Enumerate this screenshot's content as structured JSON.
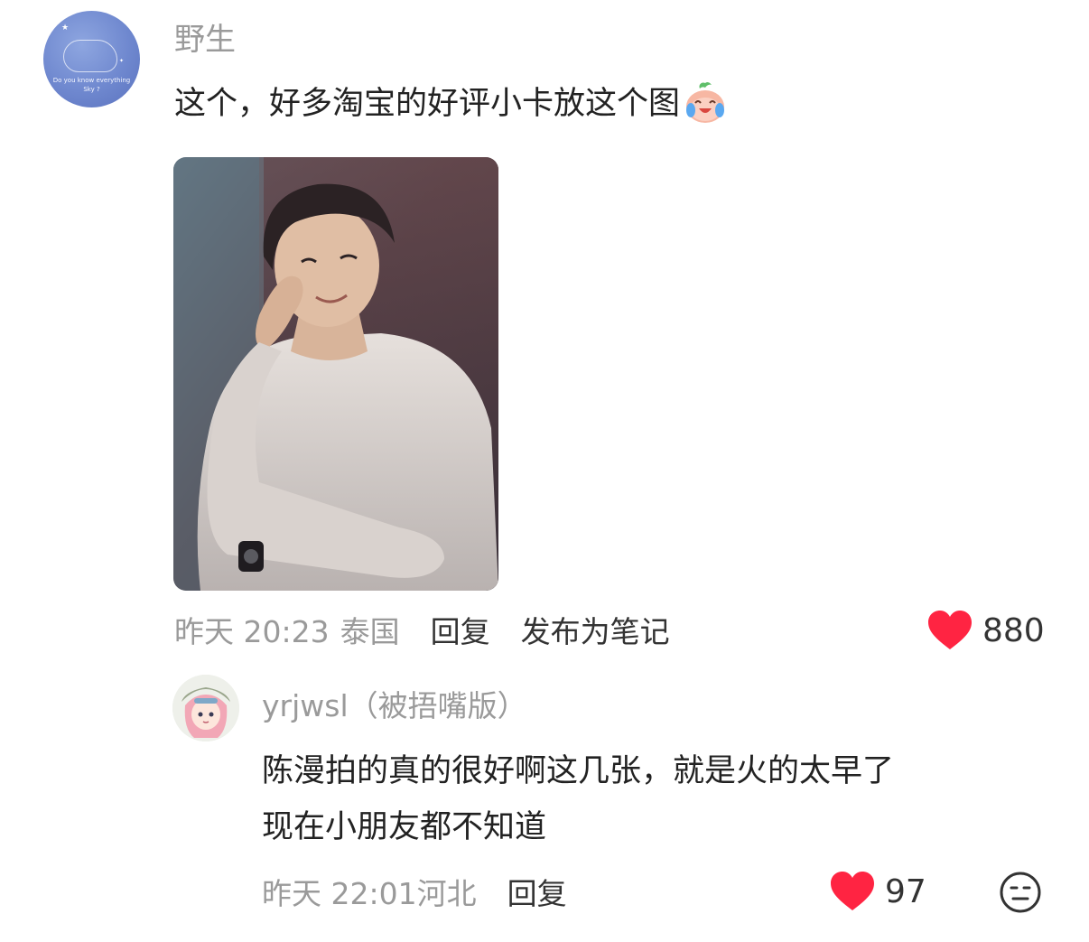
{
  "comment": {
    "author": "野生",
    "avatar_text_line1": "Do you know everything",
    "avatar_text_line2": "Sky ?",
    "text": "这个，好多淘宝的好评小卡放这个图",
    "emoji": "crying-laughing-peach-emoji",
    "time": "昨天 20:23",
    "location": "泰国",
    "reply_label": "回复",
    "publish_label": "发布为笔记",
    "likes": "880"
  },
  "reply": {
    "author": "yrjwsl（被捂嘴版）",
    "text_line1": "陈漫拍的真的很好啊这几张，就是火的太早了",
    "text_line2": "现在小朋友都不知道",
    "time": "昨天 22:01",
    "location": "河北",
    "reply_label": "回复",
    "likes": "97"
  },
  "colors": {
    "like_red": "#ff2442",
    "muted_text": "#9a9a9a",
    "body_text": "#222222"
  },
  "icons": [
    "heart-icon",
    "neutral-face-icon"
  ]
}
